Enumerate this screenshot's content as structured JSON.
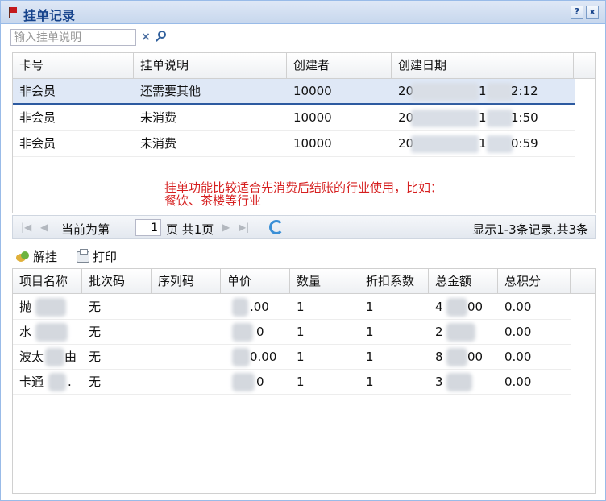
{
  "window": {
    "title": "挂单记录",
    "help_button": "?",
    "close_button": "x"
  },
  "search": {
    "placeholder": "输入挂单说明",
    "clear_label": "×"
  },
  "orders": {
    "columns": [
      "卡号",
      "挂单说明",
      "创建者",
      "创建日期"
    ],
    "rows": [
      {
        "card": "非会员",
        "note": "还需要其他",
        "creator": "10000",
        "date_start": "20",
        "date_mid": "1",
        "date_end": "2:12",
        "selected": true
      },
      {
        "card": "非会员",
        "note": "未消费",
        "creator": "10000",
        "date_start": "20",
        "date_mid": "1",
        "date_end": "1:50",
        "selected": false
      },
      {
        "card": "非会员",
        "note": "未消费",
        "creator": "10000",
        "date_start": "20",
        "date_mid": "1",
        "date_end": "0:59",
        "selected": false
      }
    ],
    "hint_line1": "挂单功能比较适合先消费后结账的行业使用，比如：",
    "hint_line2": "餐饮、茶楼等行业"
  },
  "pager": {
    "current_label": "当前为第",
    "page_value": "1",
    "total_label": "页 共1页",
    "info": "显示1-3条记录,共3条"
  },
  "actions": {
    "unhang_label": "解挂",
    "print_label": "打印"
  },
  "items": {
    "columns": [
      "项目名称",
      "批次码",
      "序列码",
      "单价",
      "数量",
      "折扣系数",
      "总金额",
      "总积分"
    ],
    "rows": [
      {
        "name": "抛",
        "batch": "无",
        "serial": "",
        "price": ".00",
        "qty": "1",
        "discount": "1",
        "total_a": "4",
        "total_b": "00",
        "points": "0.00"
      },
      {
        "name": "水",
        "batch": "无",
        "serial": "",
        "price": "0",
        "qty": "1",
        "discount": "1",
        "total_a": "2",
        "total_b": "",
        "points": "0.00"
      },
      {
        "name": "波太",
        "name_tail": "由",
        "batch": "无",
        "serial": "",
        "price": "0.00",
        "qty": "1",
        "discount": "1",
        "total_a": "8",
        "total_b": "00",
        "points": "0.00"
      },
      {
        "name": "卡通",
        "name_tail": ".",
        "batch": "无",
        "serial": "",
        "price": "0",
        "qty": "1",
        "discount": "1",
        "total_a": "3",
        "total_b": "",
        "points": "0.00"
      }
    ]
  }
}
